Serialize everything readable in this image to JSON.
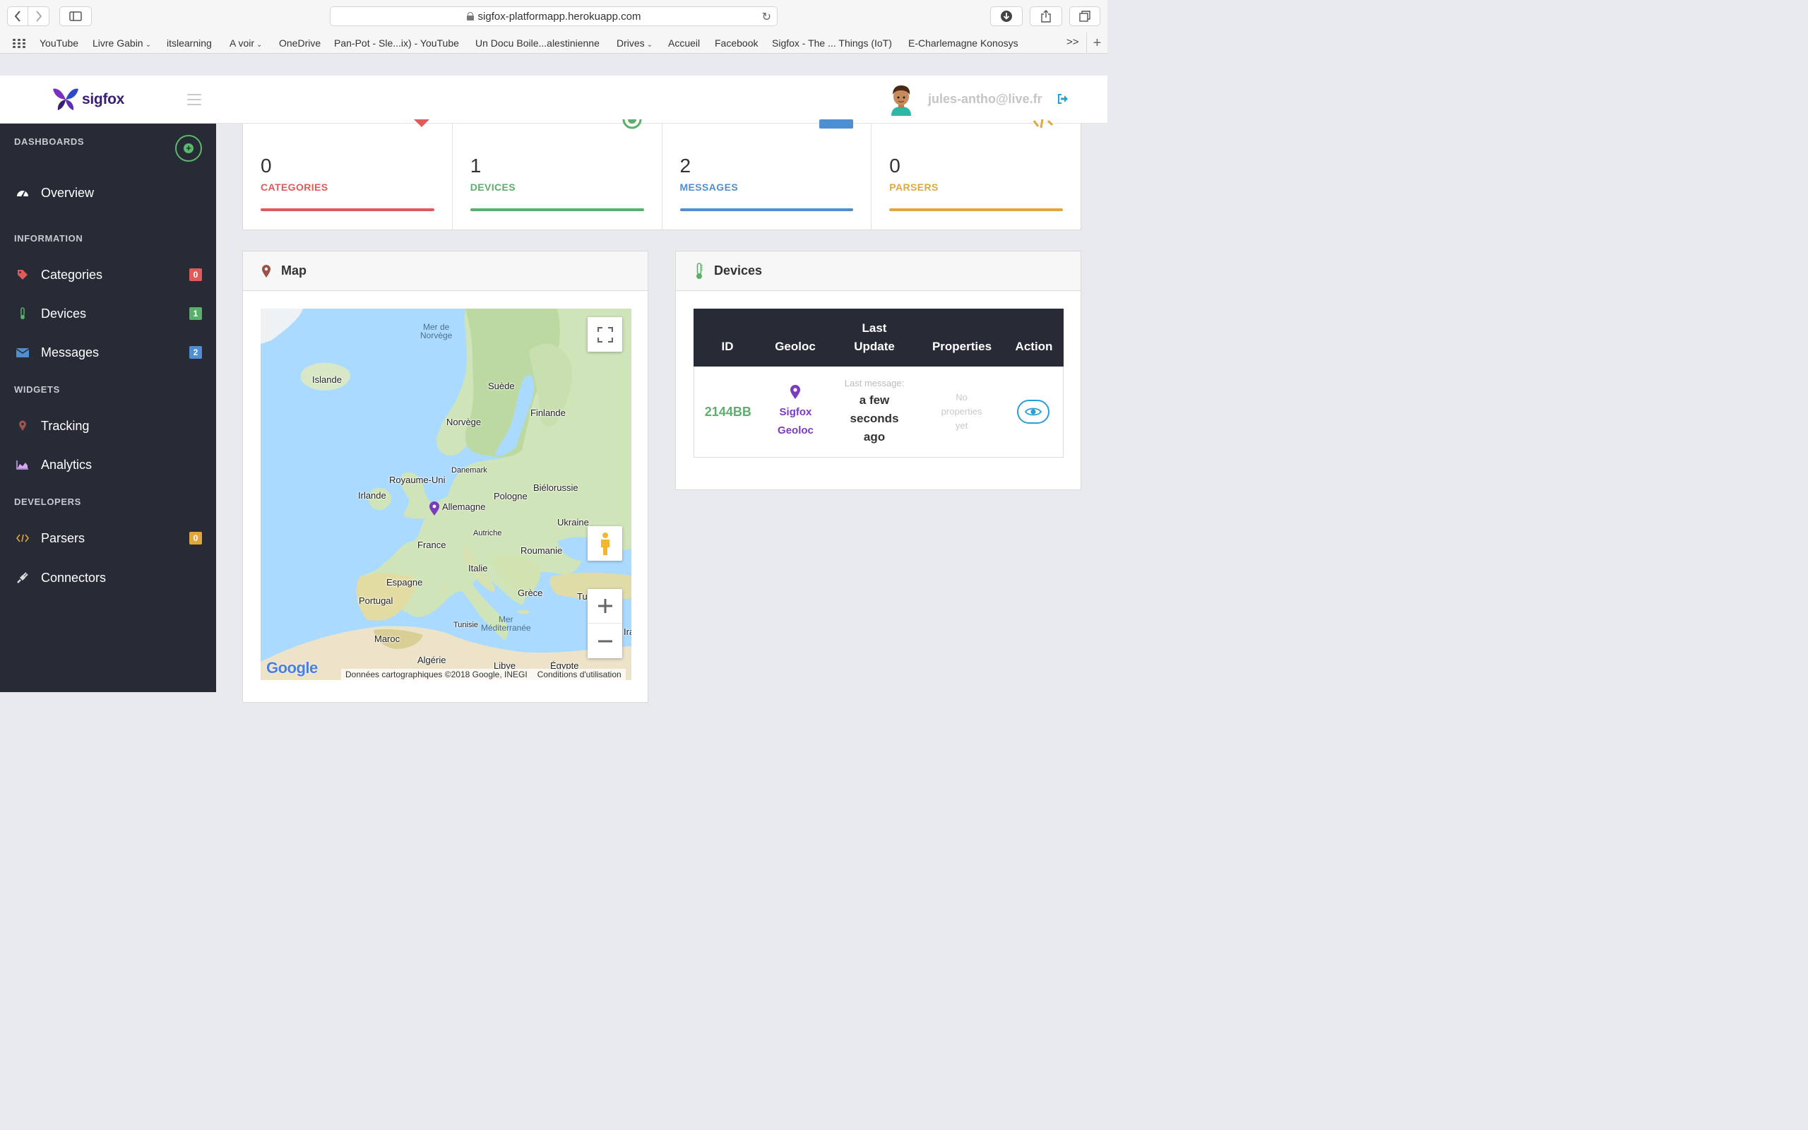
{
  "browser": {
    "url": "sigfox-platformapp.herokuapp.com",
    "bookmarks": [
      {
        "label": "YouTube"
      },
      {
        "label": "Livre Gabin",
        "dropdown": true
      },
      {
        "label": "itslearning"
      },
      {
        "label": "A voir",
        "dropdown": true
      },
      {
        "label": "OneDrive"
      },
      {
        "label": "Pan-Pot - Sle...ix) - YouTube"
      },
      {
        "label": "Un Docu Boile...alestinienne"
      },
      {
        "label": "Drives",
        "dropdown": true
      },
      {
        "label": "Accueil"
      },
      {
        "label": "Facebook"
      },
      {
        "label": "Sigfox - The ... Things (IoT)"
      },
      {
        "label": "E-Charlemagne Konosys"
      }
    ],
    "more": ">>",
    "plus": "+"
  },
  "header": {
    "logo_text": "sigfox",
    "user_email": "jules-antho@live.fr"
  },
  "sidebar": {
    "dashboards_title": "DASHBOARDS",
    "overview": "Overview",
    "information_title": "INFORMATION",
    "categories": {
      "label": "Categories",
      "badge": "0",
      "color": "#e05a5a"
    },
    "devices": {
      "label": "Devices",
      "badge": "1",
      "color": "#5bae6b"
    },
    "messages": {
      "label": "Messages",
      "badge": "2",
      "color": "#4f8fd1"
    },
    "widgets_title": "WIDGETS",
    "tracking": "Tracking",
    "analytics": "Analytics",
    "developers_title": "DEVELOPERS",
    "parsers": {
      "label": "Parsers",
      "badge": "0",
      "color": "#e0a73f"
    },
    "connectors": "Connectors"
  },
  "stats": [
    {
      "value": "0",
      "label": "CATEGORIES",
      "color": "#e05a5a"
    },
    {
      "value": "1",
      "label": "DEVICES",
      "color": "#5bae6b"
    },
    {
      "value": "2",
      "label": "MESSAGES",
      "color": "#4f8fd1"
    },
    {
      "value": "0",
      "label": "PARSERS",
      "color": "#e0a73f"
    }
  ],
  "map_panel": {
    "title": "Map",
    "labels": {
      "mer_norvege": [
        "Mer de",
        "Norvège"
      ],
      "islande": "Islande",
      "suede": "Suède",
      "finlande": "Finlande",
      "norvege": "Norvège",
      "danemark": "Danemark",
      "royaume_uni": "Royaume-Uni",
      "irlande": "Irlande",
      "bielorussie": "Biélorussie",
      "pologne": "Pologne",
      "allemagne": "Allemagne",
      "ukraine": "Ukraine",
      "autriche": "Autriche",
      "france": "France",
      "roumanie": "Roumanie",
      "italie": "Italie",
      "espagne": "Espagne",
      "portugal": "Portugal",
      "grece": "Grèce",
      "tu": "Tu",
      "ira": "Ira",
      "tunisie": "Tunisie",
      "mer_med": [
        "Mer",
        "Méditerranée"
      ],
      "maroc": "Maroc",
      "algerie": "Algérie",
      "libye": "Libye",
      "egypte": "Égypte"
    },
    "google": "Google",
    "credit": "Données cartographiques ©2018 Google, INEGI",
    "terms": "Conditions d'utilisation"
  },
  "devices_panel": {
    "title": "Devices",
    "columns": {
      "id": "ID",
      "geoloc": "Geoloc",
      "last_update": [
        "Last",
        "Update"
      ],
      "properties": "Properties",
      "action": "Action"
    },
    "rows": [
      {
        "id": "2144BB",
        "geoloc": [
          "Sigfox",
          "Geoloc"
        ],
        "last_message_label": "Last message:",
        "last_message_value": [
          "a few",
          "seconds",
          "ago"
        ],
        "properties": [
          "No",
          "properties",
          "yet"
        ]
      }
    ]
  }
}
